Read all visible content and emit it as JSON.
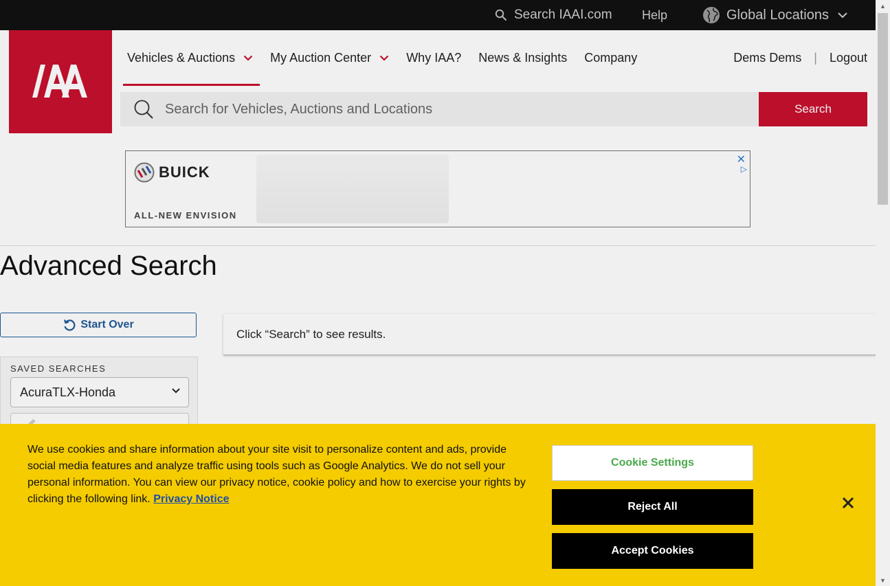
{
  "utility_bar": {
    "search_label": "Search IAAI.com",
    "help_label": "Help",
    "global_locations_label": "Global Locations"
  },
  "header": {
    "logo_text": "IAA",
    "nav": [
      {
        "label": "Vehicles & Auctions",
        "has_dropdown": true,
        "active": true
      },
      {
        "label": "My Auction Center",
        "has_dropdown": true
      },
      {
        "label": "Why IAA?"
      },
      {
        "label": "News & Insights"
      },
      {
        "label": "Company"
      }
    ],
    "user_name": "Dems Dems",
    "separator": "|",
    "logout_label": "Logout",
    "search_placeholder": "Search for Vehicles, Auctions and Locations",
    "search_button_label": "Search"
  },
  "ad": {
    "brand": "BUICK",
    "tagline": "ALL-NEW ENVISION"
  },
  "main": {
    "title": "Advanced Search",
    "start_over_label": "Start Over",
    "saved_searches_label": "SAVED SEARCHES",
    "saved_search_selected": "AcuraTLX-Honda",
    "results_placeholder": "Click “Search” to see results."
  },
  "cookie_banner": {
    "text": "We use cookies and share information about your site visit to personalize content and ads, provide social media features and analyze traffic using tools such as Google Analytics. We do not sell your personal information. You can view our privacy notice, cookie policy and how to exercise your rights by clicking the following link.",
    "privacy_link_label": "Privacy Notice",
    "settings_label": "Cookie Settings",
    "reject_label": "Reject All",
    "accept_label": "Accept Cookies"
  },
  "colors": {
    "brand_red": "#c8102e",
    "banner_yellow": "#f4cc00",
    "link_blue": "#1f5a9b",
    "utility_bar": "#111111"
  },
  "icons": [
    "search-icon",
    "globe-icon",
    "chevron-down-icon",
    "magnifier-icon",
    "restart-icon",
    "close-icon",
    "adchoices-icon",
    "loading-spinner-icon"
  ]
}
